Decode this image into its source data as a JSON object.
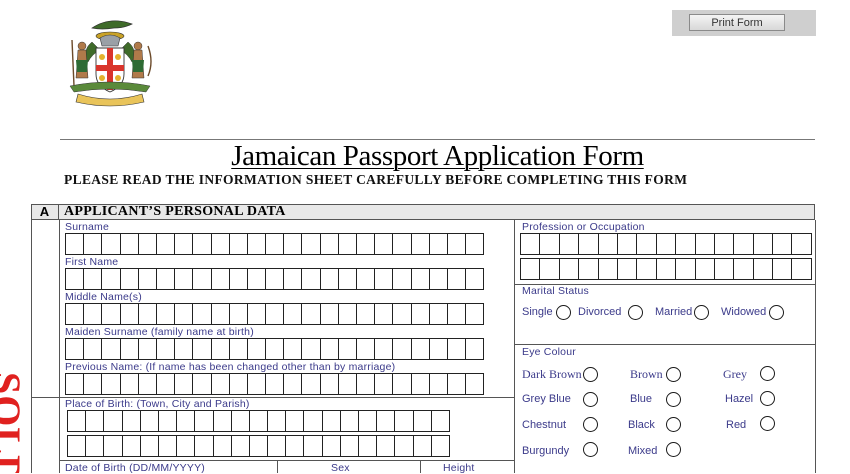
{
  "header": {
    "print_button_label": "Print Form",
    "coat_of_arms_motto": "OUT OF MANY, ONE PEOPLE",
    "title": "Jamaican Passport Application Form",
    "subtitle": "PLEASE READ THE INFORMATION SHEET CAREFULLY BEFORE COMPLETING THIS FORM"
  },
  "section": {
    "letter": "A",
    "title": "APPLICANT’S PERSONAL DATA"
  },
  "left": {
    "surname_label": "Surname",
    "first_name_label": "First Name",
    "middle_names_label": "Middle Name(s)",
    "maiden_surname_label": "Maiden Surname (family name at birth)",
    "previous_name_label": "Previous Name:  (If name has been changed other than by marriage)",
    "place_of_birth_label": "Place of Birth: (Town, City and Parish)",
    "dob_label": "Date of Birth (DD/MM/YYYY)",
    "sex_label": "Sex",
    "height_label": "Height"
  },
  "right": {
    "profession_label": "Profession or Occupation",
    "marital_status_label": "Marital Status",
    "marital_options": [
      "Single",
      "Divorced",
      "Married",
      "Widowed"
    ],
    "eye_colour_label": "Eye Colour",
    "eye_options": [
      "Dark Brown",
      "Brown",
      "Grey",
      "Grey Blue",
      "Blue",
      "Hazel",
      "Chestnut",
      "Black",
      "Red",
      "Burgundy",
      "Mixed"
    ]
  },
  "stamp": {
    "text": "SOLD",
    "color": "#e0211f"
  },
  "colors": {
    "label": "#3b3a8a",
    "border": "#555555",
    "section_fill": "#e8e8e8"
  }
}
